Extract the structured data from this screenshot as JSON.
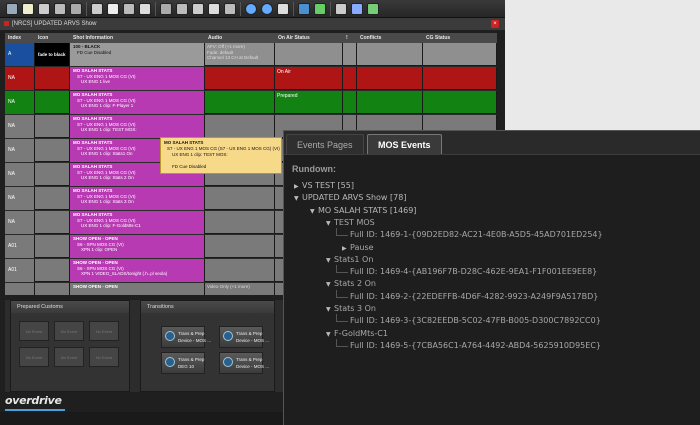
{
  "toolbar": {
    "buttons": 22
  },
  "window": {
    "title": "[NRCS] UPDATED ARVS Show"
  },
  "grid": {
    "columns": [
      "Index",
      "Icon",
      "Shot Information",
      "Audio",
      "On Air Status",
      "!",
      "Conflicts",
      "CG Status"
    ],
    "rows": [
      {
        "index": "A",
        "index_color": "#1a4fa0",
        "icon_text": "fade to black",
        "icon_bg": "#000000",
        "shot_bg": "#9a9a9a",
        "shot_lines": [
          "100 - BLACK",
          "FD Cue Disabled"
        ],
        "audio_lines": [
          "AFV: Off (+1 more)",
          "Fade: default",
          "Channel 13 CH at Default"
        ],
        "on_air": "",
        "row_bg": "#8f8f8f"
      },
      {
        "index": "NA",
        "index_color": "#b01515",
        "shot_bg": "#b83ab3",
        "shot_lines": [
          "MO SALAH STATS",
          "S7 - UX ENG 1 MOS CG (VI)",
          "UX ENG 1   live"
        ],
        "audio_lines": [],
        "on_air": "On Air",
        "row_bg": "#b01515"
      },
      {
        "index": "NA",
        "index_color": "#128212",
        "shot_bg": "#b83ab3",
        "shot_lines": [
          "MO SALAH STATS",
          "S7 - UX ENG 1 MOS CG (VI)",
          "UX ENG 1 clip:  F-Player 1"
        ],
        "audio_lines": [],
        "on_air": "Prepared",
        "row_bg": "#128212"
      },
      {
        "index": "NA",
        "index_color": "#7a7a7a",
        "shot_bg": "#b83ab3",
        "shot_lines": [
          "MO SALAH STATS",
          "S7 - UX ENG 1 MOS CG (VI)",
          "UX ENG 1 clip:  TEST MOS:"
        ],
        "audio_lines": [],
        "on_air": "",
        "row_bg": "#7a7a7a"
      },
      {
        "index": "NA",
        "index_color": "#7a7a7a",
        "shot_bg": "#b83ab3",
        "shot_lines": [
          "MO SALAH STATS",
          "S7 - UX ENG 1 MOS CG (VI)",
          "UX ENG 1 clip:  Stats1 On"
        ],
        "audio_lines": [],
        "on_air": "",
        "row_bg": "#7a7a7a"
      },
      {
        "index": "NA",
        "index_color": "#7a7a7a",
        "shot_bg": "#b83ab3",
        "shot_lines": [
          "MO SALAH STATS",
          "S7 - UX ENG 1 MOS CG (VI)",
          "UX ENG 1 clip:  Stats 2 On"
        ],
        "audio_lines": [],
        "on_air": "",
        "row_bg": "#7a7a7a"
      },
      {
        "index": "NA",
        "index_color": "#7a7a7a",
        "shot_bg": "#b83ab3",
        "shot_lines": [
          "MO SALAH STATS",
          "S7 - UX ENG 1 MOS CG (VI)",
          "UX ENG 1 clip:  Stats 3 On"
        ],
        "audio_lines": [],
        "on_air": "",
        "row_bg": "#7a7a7a"
      },
      {
        "index": "NA",
        "index_color": "#7a7a7a",
        "shot_bg": "#b83ab3",
        "shot_lines": [
          "MO SALAH STATS",
          "S7 - UX ENG 1 MOS CG (VI)",
          "UX ENG 1 clip:  F-GoldMts-C1"
        ],
        "audio_lines": [],
        "on_air": "",
        "row_bg": "#7a7a7a"
      },
      {
        "index": "A01",
        "index_color": "#7a7a7a",
        "shot_bg": "#b83ab3",
        "shot_lines": [
          "SHOW OPEN - OPEN",
          "S6 - XPN MOS CG (VI)",
          "XPN 1 clip:  OPEN"
        ],
        "audio_lines": [],
        "on_air": "",
        "row_bg": "#7a7a7a"
      },
      {
        "index": "A01",
        "index_color": "#7a7a7a",
        "shot_bg": "#b83ab3",
        "shot_lines": [
          "SHOW OPEN - OPEN",
          "S6 - XPN MOS CG (VI)",
          "XPN 1     VIDEO_SLADS/tonight (.h..pl seola)"
        ],
        "audio_lines": [],
        "on_air": "",
        "row_bg": "#7a7a7a"
      },
      {
        "index": "",
        "index_color": "#7a7a7a",
        "shot_bg": "#7a7a7a",
        "shot_lines": [
          "SHOW OPEN - OPEN"
        ],
        "audio_lines": [
          "Video Only (+1 more)"
        ],
        "on_air": "",
        "row_bg": "#7a7a7a"
      }
    ]
  },
  "tooltip": {
    "lines": [
      "MO SALAH STATS",
      "S7 - UX ENG 1 MOS CG (S7 - UX ENG 1 MOS CG) (VI)",
      "UX ENG 1 clip:  TEST MOS:",
      "",
      "FD Cue Disabled"
    ]
  },
  "bottom": {
    "prepared_title": "Prepared Customs",
    "transitions_title": "Transitions",
    "prepared_tiles": [
      "No Event",
      "No Event",
      "No Event",
      "No Event",
      "No Event",
      "No Event"
    ],
    "transition_tiles": [
      {
        "line1": "Trans & Prep",
        "line2": "Device - MOS ..."
      },
      {
        "line1": "Trans & Prep",
        "line2": "Device - MOS ..."
      },
      {
        "line1": "Trans & Prep",
        "line2": "DEG 10"
      },
      {
        "line1": "Trans & Prep",
        "line2": "Device - MOS ..."
      }
    ]
  },
  "logo": "overdrive",
  "mos": {
    "tabs": [
      "Events Pages",
      "MOS Events"
    ],
    "active_tab": 1,
    "rundown_label": "Rundown:",
    "tree": [
      {
        "level": 0,
        "expanded": false,
        "label": "VS TEST [55]"
      },
      {
        "level": 0,
        "expanded": true,
        "label": "UPDATED ARVS Show [78]"
      },
      {
        "level": 1,
        "expanded": true,
        "label": "MO SALAH STATS [1469]"
      },
      {
        "level": 2,
        "expanded": true,
        "label": "TEST MOS"
      },
      {
        "level": 3,
        "expanded": null,
        "label": "Full ID: 1469-1-{09D2ED82-AC21-4E0B-A5D5-45AD701ED254}"
      },
      {
        "level": 3,
        "expanded": false,
        "label": "Pause"
      },
      {
        "level": 2,
        "expanded": true,
        "label": "Stats1 On"
      },
      {
        "level": 3,
        "expanded": null,
        "label": "Full ID: 1469-4-{AB196F7B-D28C-462E-9EA1-F1F001EE9EE8}"
      },
      {
        "level": 2,
        "expanded": true,
        "label": "Stats 2 On"
      },
      {
        "level": 3,
        "expanded": null,
        "label": "Full ID: 1469-2-{22EDEFFB-4D6F-4282-9923-A249F9A517BD}"
      },
      {
        "level": 2,
        "expanded": true,
        "label": "Stats 3 On"
      },
      {
        "level": 3,
        "expanded": null,
        "label": "Full ID: 1469-3-{3C82EEDB-5C02-47FB-B005-D300C7892CC0}"
      },
      {
        "level": 2,
        "expanded": true,
        "label": "F-GoldMts-C1"
      },
      {
        "level": 3,
        "expanded": null,
        "label": "Full ID: 1469-5-{7CBA56C1-A764-4492-ABD4-5625910D95EC}"
      }
    ]
  },
  "colors": {
    "active_tab_border": "#777777",
    "logo_accent": "#4aa0d8",
    "tooltip_bg": "#f7d98a"
  }
}
